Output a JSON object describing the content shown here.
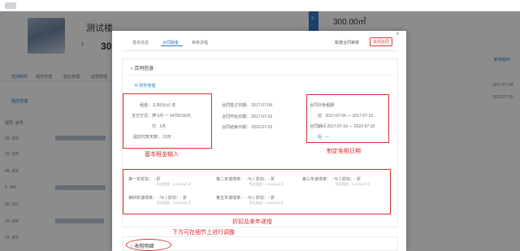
{
  "topnav": {
    "items": [
      "",
      "",
      "",
      ""
    ]
  },
  "background": {
    "title": "测试楼",
    "num_small": "1",
    "num_big": "309",
    "tabs": [
      "空间结构",
      "租控管理",
      "物业管理",
      "运营管理"
    ],
    "subtab": "租控管理",
    "rows": [
      {
        "a": "楼层",
        "b": "房号"
      },
      {
        "a": "66",
        "b": "202"
      },
      {
        "a": "22",
        "b": "205"
      },
      {
        "a": "46",
        "b": "206"
      },
      {
        "a": "5",
        "b": "205"
      },
      {
        "a": "50",
        "b": "207"
      },
      {
        "a": "20",
        "b": "208"
      },
      {
        "a": "19",
        "b": "209"
      }
    ]
  },
  "right_panel": {
    "price": "300.00㎡",
    "dates": [
      "2017-07-04",
      "2022-07-15"
    ],
    "link": "新增租约"
  },
  "modal": {
    "tabs": [
      "基本信息",
      "合同租金",
      "审核流程"
    ],
    "active_tab": "合同租金",
    "top_link": "新建合同审核",
    "top_button": "关闭合同",
    "close_label": "×",
    "section1_title": "合同信息",
    "attach_link": "附件管理",
    "rent": {
      "price_label": "租金：",
      "price_value": "2.00元/㎡·天",
      "pay_label": "支付方式：",
      "pay_value": "押 0月 一 54750.00元",
      "fu_label": "付",
      "fu_value": "1月",
      "advance_label": "提前付款天数：",
      "advance_value": "15天"
    },
    "dates": {
      "sign_label": "合同签订日期：",
      "sign": "2017-07-04",
      "start_label": "合同开始日期：",
      "start": "2017-07-16",
      "end_label": "合同结束日期：",
      "end": "2022-07-15"
    },
    "free": {
      "title": "合同外免租期",
      "from_label": "前",
      "from": "2017-07-04 — 2017-07-15",
      "post_label": "合同期间",
      "post": "2017-07-16 — 2022-07-15",
      "after_label": "后",
      "after": "—"
    },
    "discount": {
      "r1c1": "第一年折扣：",
      "r1c1v": "- 折",
      "r1c2": "第二年递增率：",
      "r1c2v": "- %丨折扣：- 折",
      "r1c3": "第三年递增率：",
      "r1c3v": "- %丨折扣：- 折",
      "r2c1": "第四年递增率：",
      "r2c1v": "- %丨折扣：- 折",
      "r2c2": "第五年递增率：",
      "r2c2v": "- %丨折扣：- 折",
      "sub": "折后租金：0.00元/㎡·天"
    },
    "annotations": {
      "basic": "基本租金输入",
      "free": "制定免租日期",
      "discount": "折扣及来年递增",
      "bottom": "下方可在细节上进行调整"
    },
    "section2_title": "收租明细"
  },
  "colors": {
    "accent": "#2f79c6",
    "annotation": "#d32f2f"
  }
}
